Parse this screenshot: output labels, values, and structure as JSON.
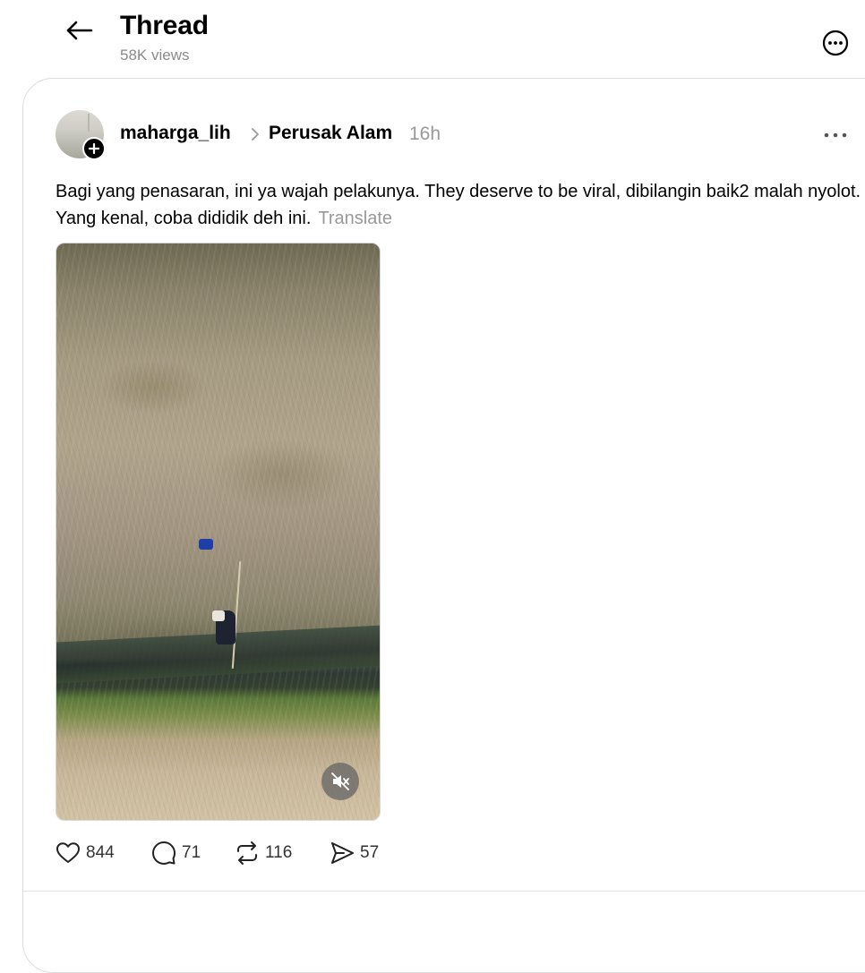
{
  "header": {
    "title": "Thread",
    "views": "58K views"
  },
  "post": {
    "username": "maharga_lih",
    "topic": "Perusak Alam",
    "time": "16h",
    "text": "Bagi yang penasaran, ini ya wajah pelakunya. They deserve to be viral, dibilangin baik2 malah nyolot. Yang kenal, coba dididik deh ini.",
    "translate_label": "Translate",
    "media": {
      "type": "video",
      "muted": true
    },
    "stats": {
      "likes": "844",
      "replies": "71",
      "reposts": "116",
      "shares": "57"
    }
  },
  "icons": {
    "back": "arrow-left-icon",
    "more_header": "ellipsis-circle-icon",
    "more_post": "ellipsis-icon",
    "follow": "plus-icon",
    "mute": "speaker-muted-icon",
    "like": "heart-icon",
    "reply": "comment-icon",
    "repost": "repost-icon",
    "share": "send-icon"
  }
}
